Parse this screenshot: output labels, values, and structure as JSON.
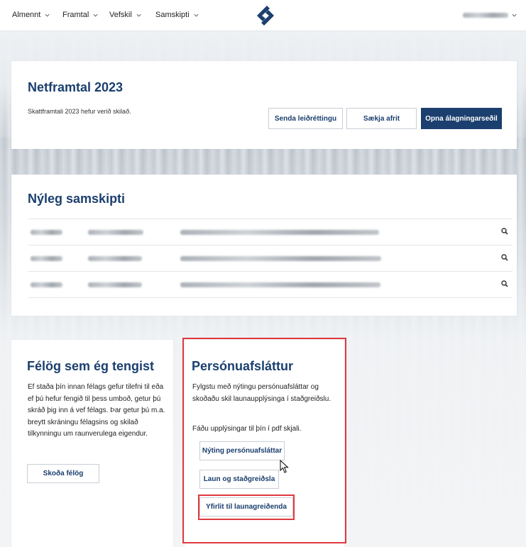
{
  "nav": {
    "items": [
      "Almennt",
      "Framtal",
      "Vefskil",
      "Samskipti"
    ]
  },
  "netframtal": {
    "title": "Netframtal 2023",
    "status": "Skattframtali 2023 hefur verið skilað.",
    "buttons": [
      "Senda leiðréttingu",
      "Sækja afrit",
      "Opna álagningarseðil"
    ]
  },
  "samskipti": {
    "title": "Nýleg samskipti",
    "row_count": 3
  },
  "felog": {
    "title": "Félög sem ég tengist",
    "body": "Ef staða þín innan félags gefur tilefni til eða ef þú hefur fengið til þess umboð, getur þú skráð þig inn á vef félags. Þar getur þú m.a. breytt skráningu félagsins og skilað tilkynningu um raunverulega eigendur.",
    "button": "Skoða félög"
  },
  "personuafslattur": {
    "title": "Persónuafsláttur",
    "body": "Fylgstu með nýtingu persónuafsláttar og skoðaðu skil launaupplýsinga í staðgreiðslu.",
    "body2": "Fáðu upplýsingar til þín í pdf skjali.",
    "buttons": [
      "Nýting persónuafsláttar",
      "Laun og staðgreiðsla",
      "Yfirlit til launagreiðenda"
    ]
  },
  "colors": {
    "brand": "#1b3f6e",
    "highlight": "#e0393e"
  }
}
